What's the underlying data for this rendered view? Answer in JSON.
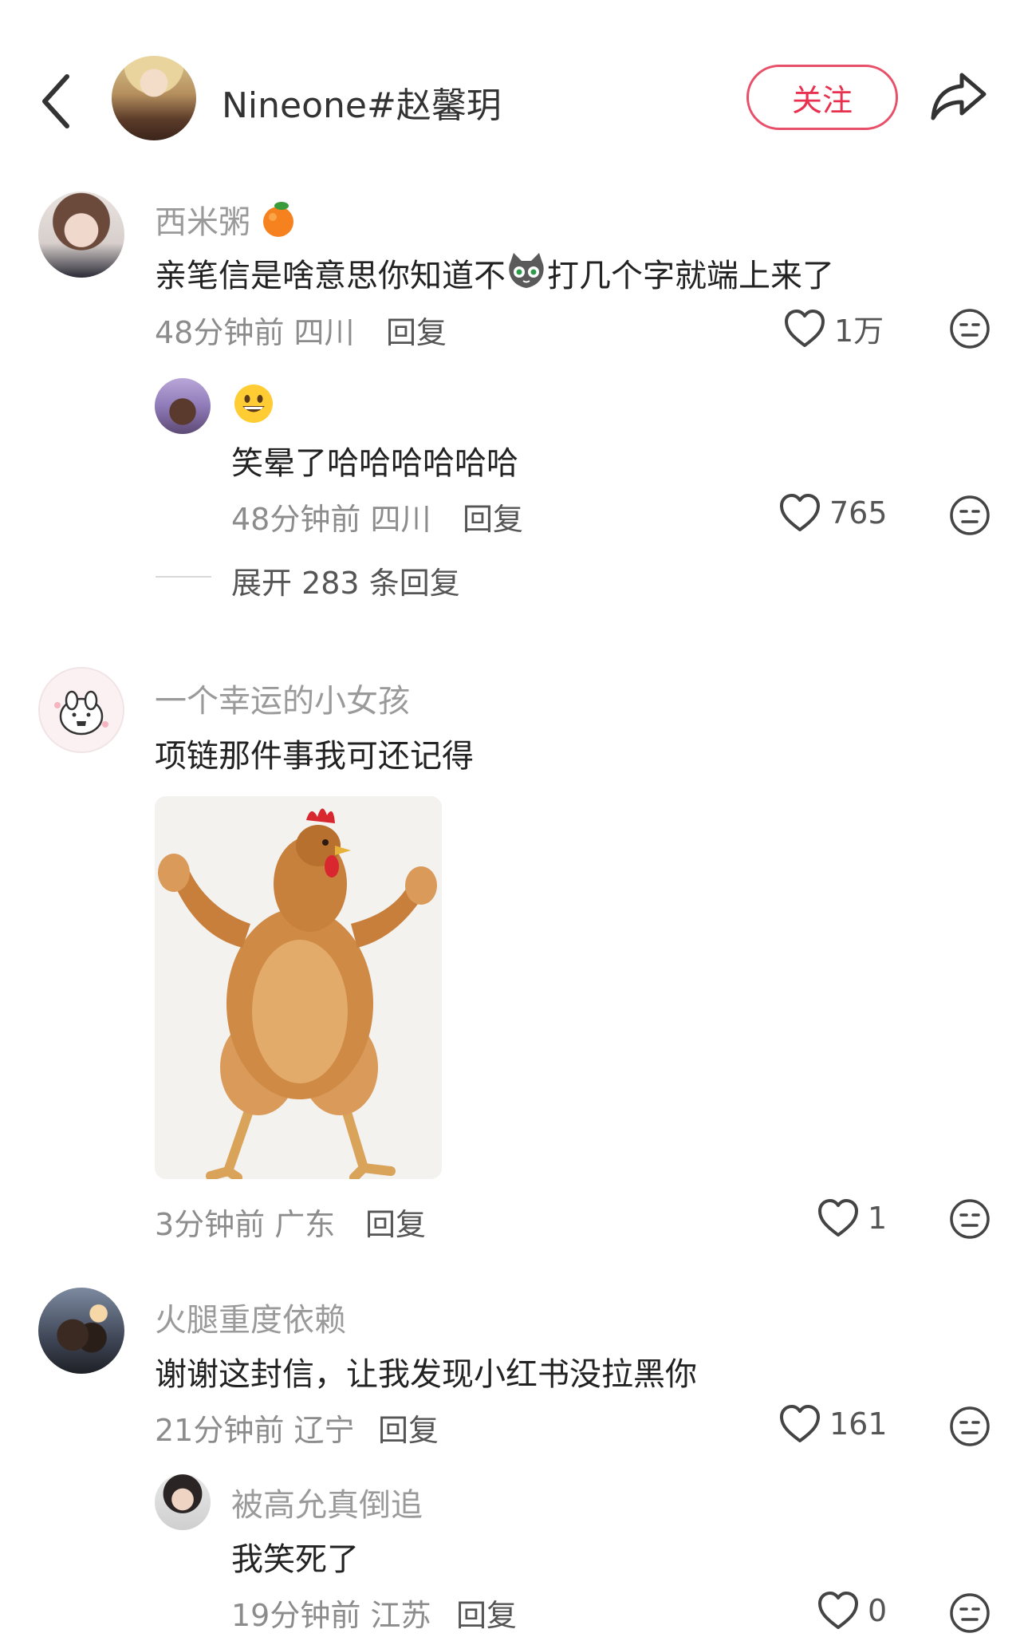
{
  "header": {
    "author_name": "Nineone#赵馨玥",
    "follow_label": "关注"
  },
  "comments": [
    {
      "user": "西米粥",
      "user_emoji": "orange",
      "text_before": "亲笔信是啥意思你知道不",
      "text_emoji": "cat-face",
      "text_after": "打几个字就端上来了",
      "time": "48分钟前",
      "location": "四川",
      "reply_label": "回复",
      "likes": "1万",
      "replies": [
        {
          "user_emoji": "grinning-face",
          "text": "笑晕了哈哈哈哈哈哈",
          "time": "48分钟前",
          "location": "四川",
          "reply_label": "回复",
          "likes": "765"
        }
      ],
      "expand_label": "展开 283 条回复"
    },
    {
      "user": "一个幸运的小女孩",
      "text": "项链那件事我可还记得",
      "image": "muscle-chicken",
      "time": "3分钟前",
      "location": "广东",
      "reply_label": "回复",
      "likes": "1"
    },
    {
      "user": "火腿重度依赖",
      "text": "谢谢这封信，让我发现小红书没拉黑你",
      "time": "21分钟前",
      "location": "辽宁",
      "reply_label": "回复",
      "likes": "161",
      "replies": [
        {
          "user": "被高允真倒追",
          "text": "我笑死了",
          "time": "19分钟前",
          "location": "江苏",
          "reply_label": "回复",
          "likes": "0"
        }
      ]
    }
  ],
  "colors": {
    "accent": "#e8304f",
    "muted_text": "#9a9a9a",
    "body_text": "#222222"
  },
  "icons": [
    "back-arrow-icon",
    "share-icon",
    "heart-icon",
    "dislike-face-icon"
  ]
}
